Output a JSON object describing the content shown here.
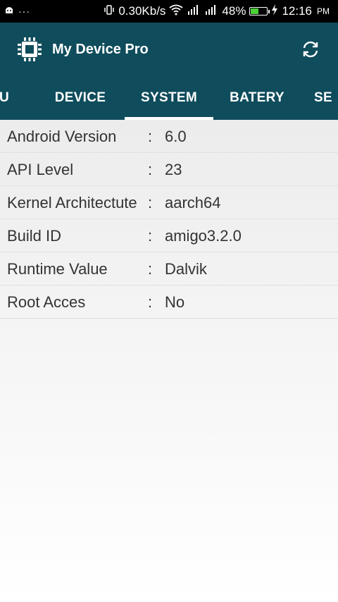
{
  "status_bar": {
    "notif_icon": "android-icon",
    "dots": "···",
    "speed": "0.30Kb/s",
    "battery_pct": "48%",
    "battery_level": 0.48,
    "time": "12:16",
    "ampm": "PM"
  },
  "app_bar": {
    "title": "My Device Pro",
    "logo_icon": "chip-icon",
    "action_icon": "refresh-icon"
  },
  "tabs": [
    {
      "label": "U",
      "active": false
    },
    {
      "label": "DEVICE",
      "active": false
    },
    {
      "label": "SYSTEM",
      "active": true
    },
    {
      "label": "BATERY",
      "active": false
    },
    {
      "label": "SE",
      "active": false
    }
  ],
  "rows": [
    {
      "label": "Android Version",
      "sep": ":",
      "value": "6.0"
    },
    {
      "label": "API Level",
      "sep": ":",
      "value": "23"
    },
    {
      "label": "Kernel Architectute",
      "sep": ":",
      "value": "aarch64"
    },
    {
      "label": "Build ID",
      "sep": ":",
      "value": "amigo3.2.0"
    },
    {
      "label": "Runtime Value",
      "sep": ":",
      "value": "Dalvik"
    },
    {
      "label": "Root Acces",
      "sep": ":",
      "value": "No"
    }
  ],
  "colors": {
    "primary": "#0f4c5c",
    "battery": "#4cd136"
  }
}
